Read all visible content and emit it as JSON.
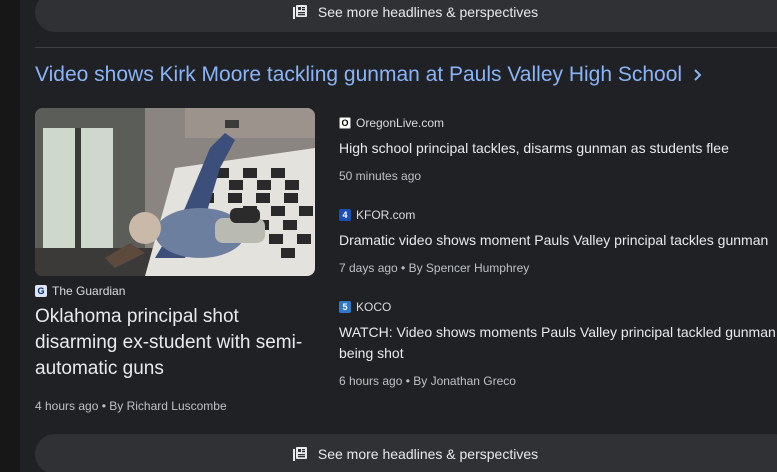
{
  "more_headlines_label": "See more headlines & perspectives",
  "cluster": {
    "title": "Video shows Kirk Moore tackling gunman at Pauls Valley High School"
  },
  "hero": {
    "source": "The Guardian",
    "headline": "Oklahoma principal shot disarming ex-student with semi-automatic guns",
    "meta": "4 hours ago • By Richard Luscombe"
  },
  "stories": [
    {
      "source": "OregonLive.com",
      "logo_icon": "oregonlive-logo",
      "headline": "High school principal tackles, disarms gunman as students flee",
      "meta": "50 minutes ago"
    },
    {
      "source": "KFOR.com",
      "logo_icon": "kfor-logo",
      "headline": "Dramatic video shows moment Pauls Valley principal tackles gunman",
      "meta": "7 days ago • By Spencer Humphrey"
    },
    {
      "source": "KOCO",
      "logo_icon": "koco-logo",
      "headline": "WATCH: Video shows moments Pauls Valley principal tackled gunman being shot",
      "meta": "6 hours ago • By Jonathan Greco"
    }
  ],
  "colors": {
    "background": "#202124",
    "link": "#8ab4f8",
    "text": "#e8eaed",
    "muted": "#bdc1c6",
    "button": "#303134"
  }
}
